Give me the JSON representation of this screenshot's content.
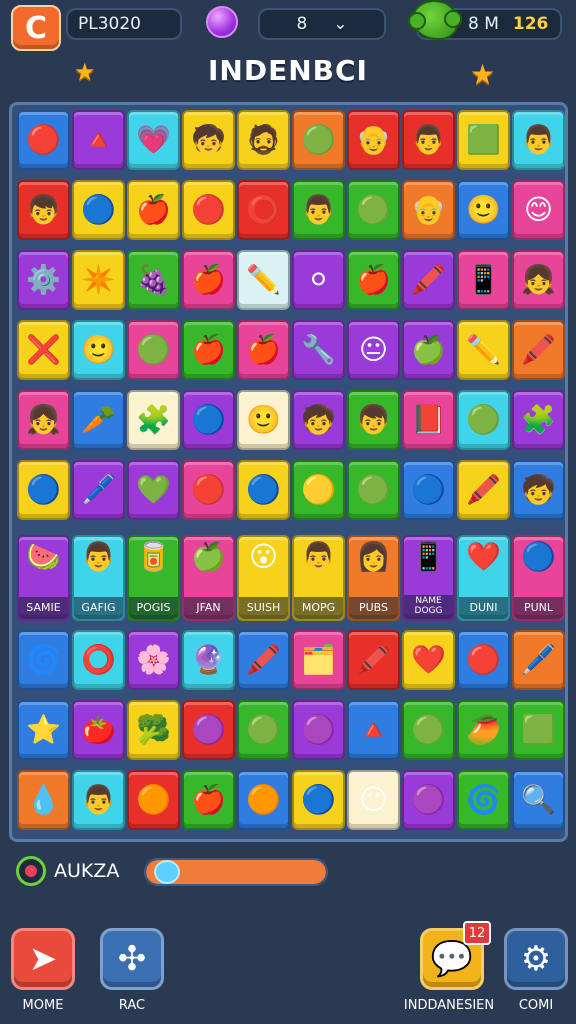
{
  "header": {
    "app_icon": "C",
    "player": "PL3020",
    "gem_icon": "purple-gem-icon",
    "level": "8",
    "level_dropdown": "⌄",
    "score_label": "8 M",
    "score_best": "126"
  },
  "title": "INDENBCI",
  "colors": {
    "red": "#e8302a",
    "orange": "#f07a2a",
    "yellow": "#f7d21a",
    "green": "#36b82a",
    "cyan": "#3fd4ea",
    "blue": "#2f7de0",
    "purple": "#9a3ad8",
    "pink": "#e8449a",
    "cream": "#fbf2cf",
    "light": "#d9f3f4"
  },
  "board": {
    "rows": [
      [
        [
          "blue",
          "🔴"
        ],
        [
          "purple",
          "🔺"
        ],
        [
          "cyan",
          "💗"
        ],
        [
          "yellow",
          "🧒"
        ],
        [
          "yellow",
          "🧔"
        ],
        [
          "orange",
          "🟢"
        ],
        [
          "red",
          "👴"
        ],
        [
          "red",
          "👨"
        ],
        [
          "yellow",
          "🟩"
        ],
        [
          "cyan",
          "👨"
        ]
      ],
      [
        [
          "red",
          "👦"
        ],
        [
          "yellow",
          "🔵"
        ],
        [
          "yellow",
          "🍎"
        ],
        [
          "yellow",
          "🔴"
        ],
        [
          "red",
          "⭕"
        ],
        [
          "green",
          "👨"
        ],
        [
          "green",
          "🟢"
        ],
        [
          "orange",
          "👴"
        ],
        [
          "blue",
          "🙂"
        ],
        [
          "pink",
          "😊"
        ]
      ],
      [
        [
          "purple",
          "⚙️"
        ],
        [
          "yellow",
          "✴️"
        ],
        [
          "green",
          "🍇"
        ],
        [
          "pink",
          "🍎"
        ],
        [
          "light",
          "✏️"
        ],
        [
          "purple",
          "⚪"
        ],
        [
          "green",
          "🍎"
        ],
        [
          "purple",
          "🖍️"
        ],
        [
          "pink",
          "📱"
        ],
        [
          "pink",
          "👧"
        ]
      ],
      [
        [
          "yellow",
          "❌"
        ],
        [
          "cyan",
          "🙂"
        ],
        [
          "pink",
          "🟢"
        ],
        [
          "green",
          "🍎"
        ],
        [
          "pink",
          "🍎"
        ],
        [
          "purple",
          "🔧"
        ],
        [
          "purple",
          "😐"
        ],
        [
          "purple",
          "🍏"
        ],
        [
          "yellow",
          "✏️"
        ],
        [
          "orange",
          "🖍️"
        ]
      ],
      [
        [
          "pink",
          "👧"
        ],
        [
          "blue",
          "🥕"
        ],
        [
          "cream",
          "🧩"
        ],
        [
          "purple",
          "🔵"
        ],
        [
          "cream",
          "🙂"
        ],
        [
          "purple",
          "🧒"
        ],
        [
          "green",
          "👦"
        ],
        [
          "pink",
          "📕"
        ],
        [
          "cyan",
          "🟢"
        ],
        [
          "purple",
          "🧩"
        ]
      ],
      [
        [
          "yellow",
          "🔵"
        ],
        [
          "purple",
          "🖊️"
        ],
        [
          "purple",
          "💚"
        ],
        [
          "pink",
          "🔴"
        ],
        [
          "yellow",
          "🔵"
        ],
        [
          "green",
          "🟡"
        ],
        [
          "green",
          "🟢"
        ],
        [
          "blue",
          "🔵"
        ],
        [
          "yellow",
          "🖍️"
        ],
        [
          "blue",
          "🧒"
        ]
      ]
    ],
    "labeled_row": [
      {
        "color": "purple",
        "icon": "🍉",
        "label": "SAMIE"
      },
      {
        "color": "cyan",
        "icon": "👨",
        "label": "GAFIG"
      },
      {
        "color": "green",
        "icon": "🥫",
        "label": "POGIS"
      },
      {
        "color": "pink",
        "icon": "🍏",
        "label": "JFAN"
      },
      {
        "color": "yellow",
        "icon": "😮",
        "label": "SUISH"
      },
      {
        "color": "yellow",
        "icon": "👨",
        "label": "MOPG"
      },
      {
        "color": "orange",
        "icon": "👩",
        "label": "PUBS"
      },
      {
        "color": "purple",
        "icon": "📱",
        "label": "NAME\nDOGG"
      },
      {
        "color": "cyan",
        "icon": "❤️",
        "label": "DUNI"
      },
      {
        "color": "pink",
        "icon": "🔵",
        "label": "PUNL"
      }
    ],
    "lower_rows": [
      [
        [
          "blue",
          "🌀"
        ],
        [
          "cyan",
          "⭕"
        ],
        [
          "purple",
          "🌸"
        ],
        [
          "cyan",
          "🔮"
        ],
        [
          "blue",
          "🖍️"
        ],
        [
          "pink",
          "🗂️"
        ],
        [
          "red",
          "🖍️"
        ],
        [
          "yellow",
          "❤️"
        ],
        [
          "blue",
          "🔴"
        ],
        [
          "orange",
          "🖊️"
        ]
      ],
      [
        [
          "blue",
          "⭐"
        ],
        [
          "purple",
          "🍅"
        ],
        [
          "yellow",
          "🥦"
        ],
        [
          "red",
          "🟣"
        ],
        [
          "green",
          "🟢"
        ],
        [
          "purple",
          "🟣"
        ],
        [
          "blue",
          "🔺"
        ],
        [
          "green",
          "🟢"
        ],
        [
          "green",
          "🥭"
        ],
        [
          "green",
          "🟩"
        ]
      ],
      [
        [
          "orange",
          "💧"
        ],
        [
          "cyan",
          "👨"
        ],
        [
          "red",
          "🟠"
        ],
        [
          "green",
          "🍎"
        ],
        [
          "blue",
          "🟠"
        ],
        [
          "yellow",
          "🔵"
        ],
        [
          "cream",
          "😶"
        ],
        [
          "purple",
          "🟣"
        ],
        [
          "green",
          "🌀"
        ],
        [
          "blue",
          "🔍"
        ]
      ]
    ]
  },
  "progress": {
    "label": "AUKZA",
    "value": 0.05
  },
  "buttons": {
    "more": {
      "icon": "➤",
      "label": "MOME"
    },
    "rac": {
      "icon": "✣",
      "label": "RAC"
    },
    "ind": {
      "icon": "💬",
      "label": "INDDANESIEN",
      "badge": "12"
    },
    "com": {
      "icon": "⚙",
      "label": "COMI"
    }
  }
}
